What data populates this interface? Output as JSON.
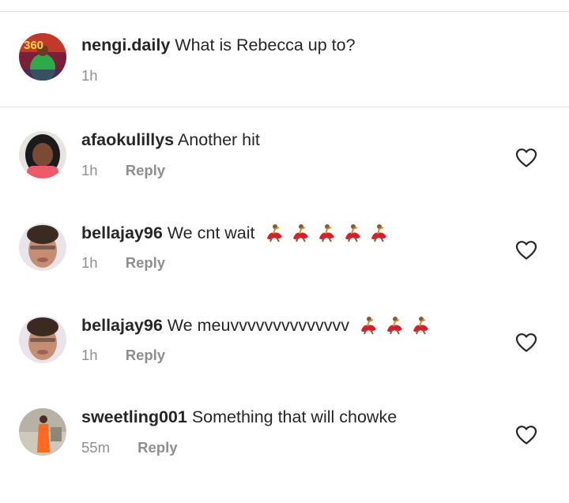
{
  "caption": {
    "username": "nengi.daily",
    "text": "What is Rebecca up to?",
    "time": "1h",
    "avatar_badge": "360"
  },
  "reply_label": "Reply",
  "icons": {
    "like": "heart-outline-icon",
    "emoji": "dancer-emoji"
  },
  "comments": [
    {
      "username": "afaokulillys",
      "text": "Another hit",
      "time": "1h"
    },
    {
      "username": "bellajay96",
      "text": "We cnt wait",
      "time": "1h",
      "emoji_count": 5
    },
    {
      "username": "bellajay96",
      "text": "We meuvvvvvvvvvvvvvv",
      "time": "1h",
      "emoji_count": 3
    },
    {
      "username": "sweetling001",
      "text": "Something that will chowke",
      "time": "55m"
    }
  ],
  "colors": {
    "text": "#262626",
    "secondary": "#8e8e8e",
    "divider": "#dbdbdb"
  }
}
